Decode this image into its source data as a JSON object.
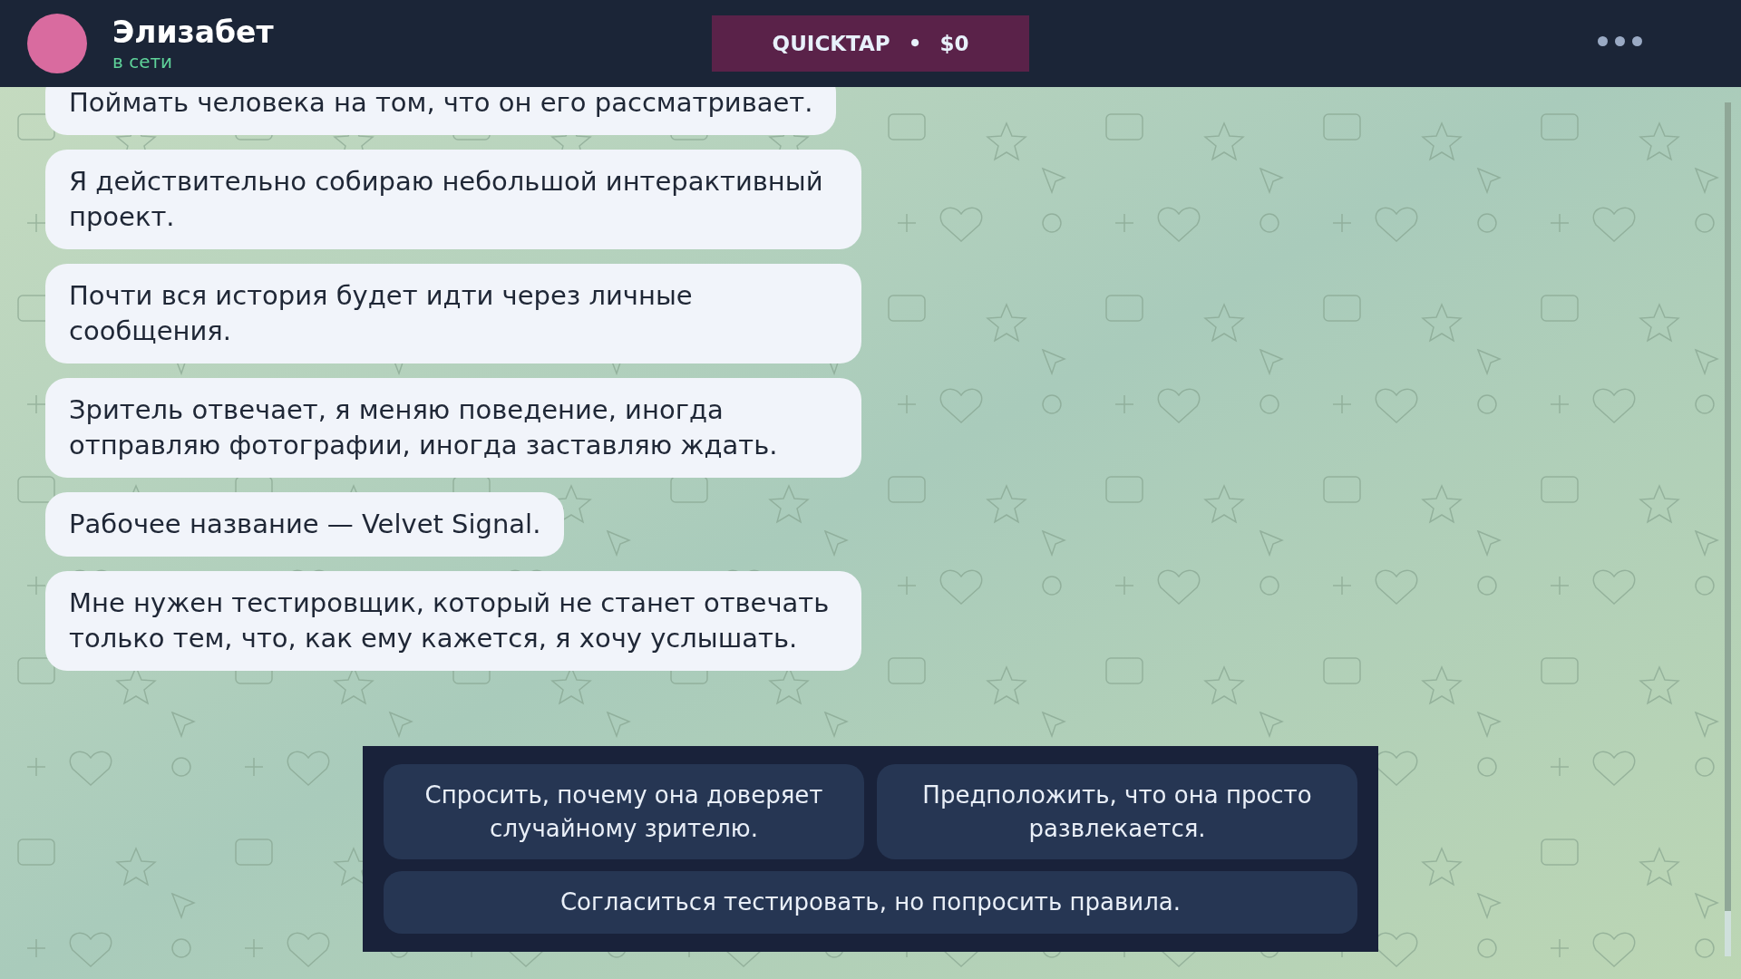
{
  "header": {
    "contact": {
      "name": "Элизабет",
      "status": "в сети"
    },
    "badge": {
      "brand": "QUICKTAP",
      "separator": "•",
      "balance": "$0"
    }
  },
  "messages": [
    {
      "text": "Поймать человека на том, что он его рассматривает."
    },
    {
      "text": "Я действительно собираю небольшой интерактивный проект."
    },
    {
      "text": "Почти вся история будет идти через личные сообщения."
    },
    {
      "text": "Зритель отвечает, я меняю поведение, иногда отправляю фотографии, иногда заставляю ждать."
    },
    {
      "text": "Рабочее название — Velvet Signal."
    },
    {
      "text": "Мне нужен тестировщик, который не станет отвечать только тем, что, как ему кажется, я хочу услышать."
    }
  ],
  "choices": [
    {
      "label": "Спросить, почему она доверяет случайному зрителю."
    },
    {
      "label": "Предположить, что она просто развлекается."
    },
    {
      "label": "Согласиться тестировать, но попросить правила."
    }
  ]
}
